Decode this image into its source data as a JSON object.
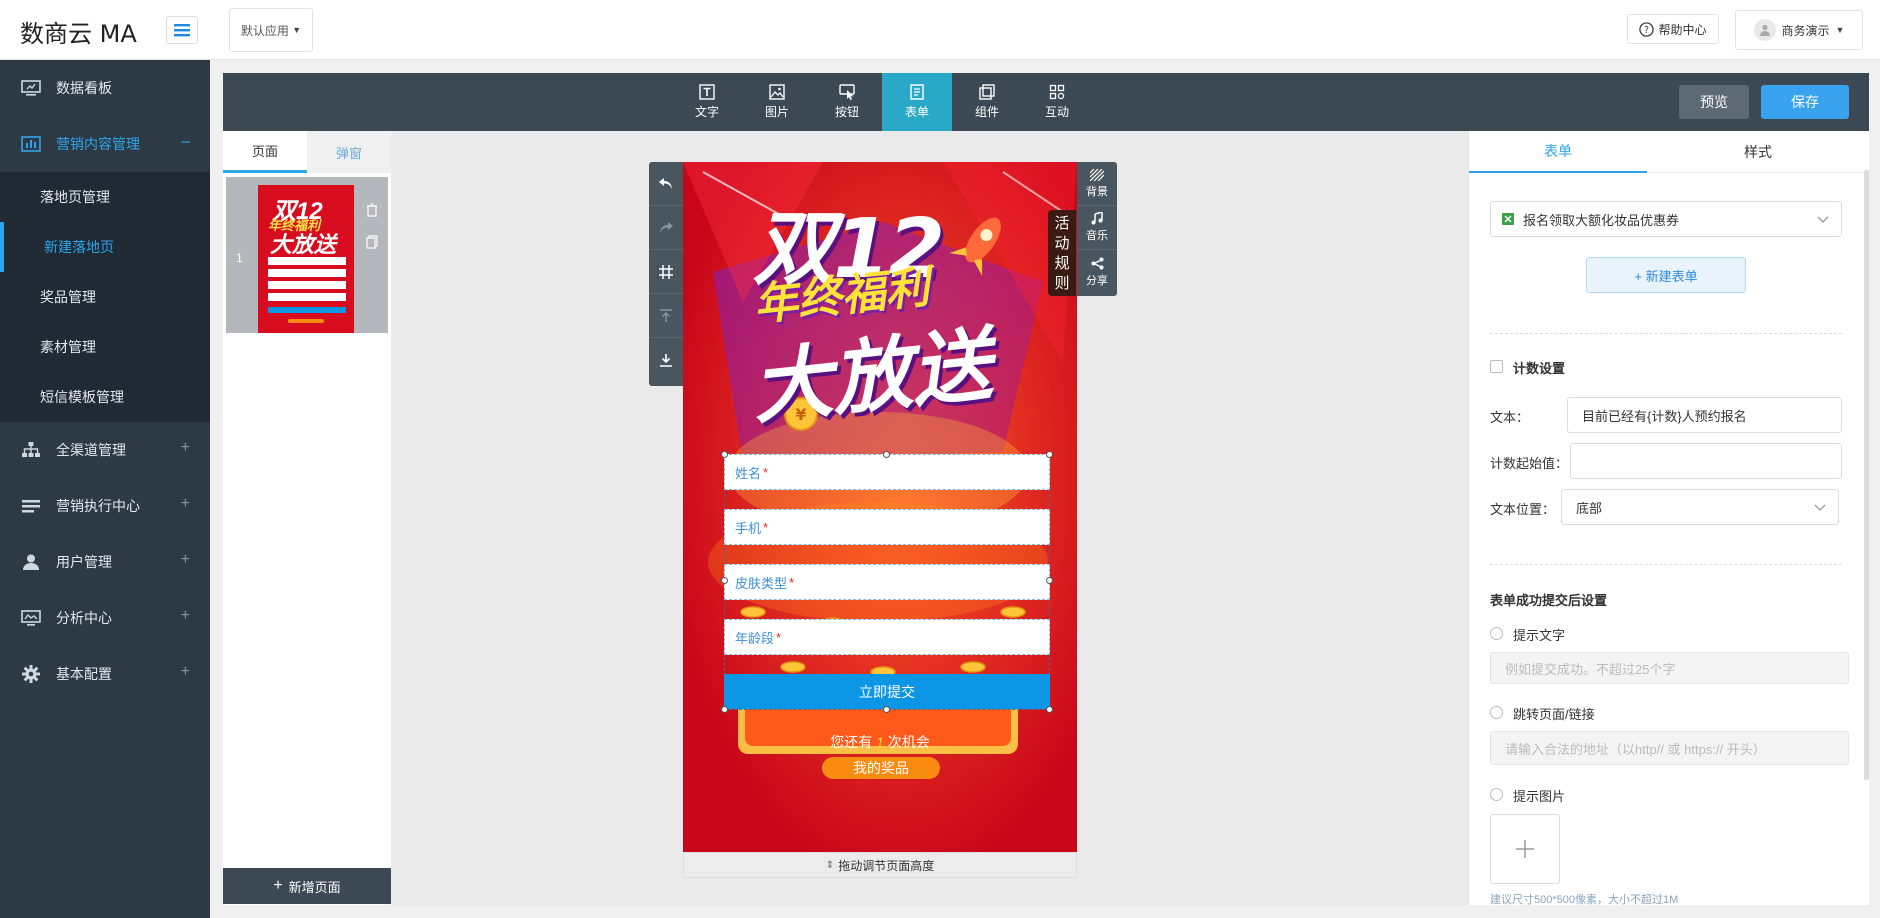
{
  "header": {
    "brand": "数商云 MA",
    "app_select": "默认应用",
    "help": "帮助中心",
    "user": "商务演示"
  },
  "sidebar": {
    "items": [
      {
        "label": "数据看板",
        "icon": "dashboard-icon"
      },
      {
        "label": "营销内容管理",
        "icon": "chart-bar-icon",
        "toggle": "–",
        "active": true
      },
      {
        "label": "全渠道管理",
        "icon": "sitemap-icon",
        "toggle": "+"
      },
      {
        "label": "营销执行中心",
        "icon": "list-icon",
        "toggle": "+"
      },
      {
        "label": "用户管理",
        "icon": "user-icon",
        "toggle": "+"
      },
      {
        "label": "分析中心",
        "icon": "monitor-icon",
        "toggle": "+"
      },
      {
        "label": "基本配置",
        "icon": "gear-icon",
        "toggle": "+"
      }
    ],
    "subitems": [
      "落地页管理",
      "新建落地页",
      "奖品管理",
      "素材管理",
      "短信模板管理"
    ]
  },
  "toolbar": {
    "tools": [
      "文字",
      "图片",
      "按钮",
      "表单",
      "组件",
      "互动"
    ],
    "active_tool": "表单",
    "preview": "预览",
    "save": "保存"
  },
  "pages_panel": {
    "tabs": [
      "页面",
      "弹窗"
    ],
    "page_number": "1",
    "add_page": "新增页面"
  },
  "canvas": {
    "headline1": "双12",
    "headline2": "年终福利",
    "headline3": "大放送",
    "activity_rules": [
      "活",
      "动",
      "规",
      "则"
    ],
    "right_tools": [
      "背景",
      "音乐",
      "分享"
    ],
    "fields": [
      {
        "label": "姓名",
        "req": "*"
      },
      {
        "label": "手机",
        "req": "*"
      },
      {
        "label": "皮肤类型",
        "req": "*"
      },
      {
        "label": "年龄段",
        "req": "*"
      }
    ],
    "submit": "立即提交",
    "chance_prefix": "您还有",
    "chance_count": "1",
    "chance_suffix": "次机会",
    "prize_button": "我的奖品",
    "drag_hint": "拖动调节页面高度"
  },
  "props": {
    "tabs": [
      "表单",
      "样式"
    ],
    "form_select": "报名领取大额化妆品优惠券",
    "new_form": "+ 新建表单",
    "count_setting": "计数设置",
    "text_label": "文本：",
    "text_value": "目前已经有{计数}人预约报名",
    "count_start_label": "计数起始值：",
    "count_start_value": "",
    "text_pos_label": "文本位置：",
    "text_pos_value": "底部",
    "success_title": "表单成功提交后设置",
    "opt_tip": "提示文字",
    "tip_placeholder": "例如提交成功。不超过25个字",
    "opt_redirect": "跳转页面/链接",
    "redirect_placeholder": "请输入合法的地址（以http// 或 https:// 开头）",
    "opt_image": "提示图片",
    "image_hint": "建议尺寸500*500像素，大小不超过1M"
  }
}
